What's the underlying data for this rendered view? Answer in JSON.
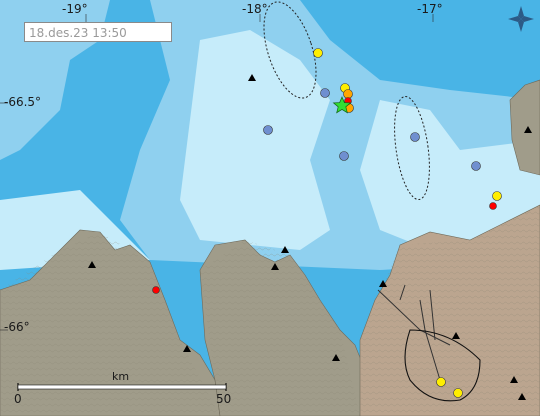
{
  "map": {
    "timestamp": "18.des.23  13:50",
    "lon_labels": [
      "-19°",
      "-18°",
      "-17°"
    ],
    "lat_labels": [
      "-66.5°",
      "-66°"
    ],
    "scale": {
      "unit": "km",
      "start": "0",
      "end": "50"
    },
    "compass_icon": "compass-rose-icon",
    "colors": {
      "deep_sea": "#49b4e6",
      "mid_sea": "#8fd0ef",
      "shallow_sea": "#c6ecfa",
      "land": "#a09c8a",
      "peninsula": "#bba58f",
      "quake_recent": "#ff0000",
      "quake_orange": "#ffa500",
      "quake_yellow": "#ffee00",
      "quake_old": "#6f8fd0",
      "largest_quake_star": "#33dd33"
    },
    "legend_marks": [
      "triangle-station-icon",
      "star-largest-quake-icon"
    ]
  }
}
